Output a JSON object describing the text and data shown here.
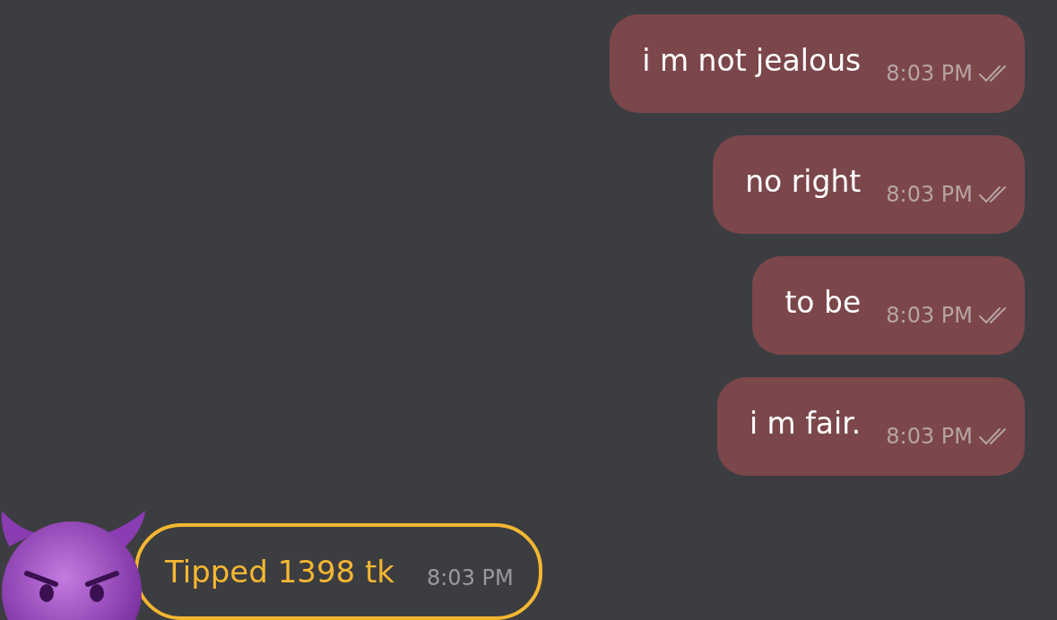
{
  "messages": [
    {
      "kind": "outgoing",
      "text": "i m not jealous",
      "time": "8:03 PM",
      "read": true
    },
    {
      "kind": "outgoing",
      "text": "no right",
      "time": "8:03 PM",
      "read": true
    },
    {
      "kind": "outgoing",
      "text": "to be",
      "time": "8:03 PM",
      "read": true
    },
    {
      "kind": "outgoing",
      "text": "i m fair.",
      "time": "8:03 PM",
      "read": true
    },
    {
      "kind": "tip",
      "text": "Tipped 1398 tk",
      "time": "8:03 PM"
    }
  ]
}
